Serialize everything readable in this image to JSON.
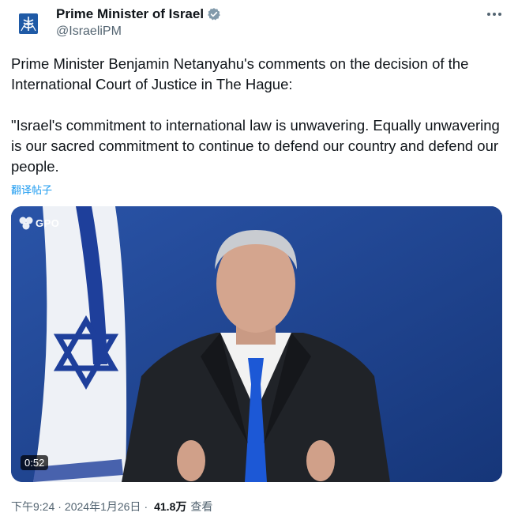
{
  "author": {
    "display_name": "Prime Minister of Israel",
    "handle": "@IsraeliPM",
    "verified_badge_icon": "verified-check-icon",
    "avatar_icon": "israel-emblem-icon",
    "badge_color": "#829aab"
  },
  "tweet": {
    "text": "Prime Minister Benjamin Netanyahu's comments on the decision of the International Court of Justice in The Hague:\n\n\"Israel's commitment to international law is unwavering. Equally unwavering is our sacred commitment to continue to defend our country and defend our people.",
    "translate_label": "翻译帖子"
  },
  "media": {
    "watermark": "GPO",
    "duration": "0:52"
  },
  "meta": {
    "time": "下午9:24",
    "separator": "·",
    "date": "2024年1月26日",
    "views_count": "41.8万",
    "views_label": "查看"
  },
  "colors": {
    "text": "#0f1419",
    "secondary": "#536471",
    "link": "#1d9bf0",
    "video_bg": "#1d3f8a"
  }
}
